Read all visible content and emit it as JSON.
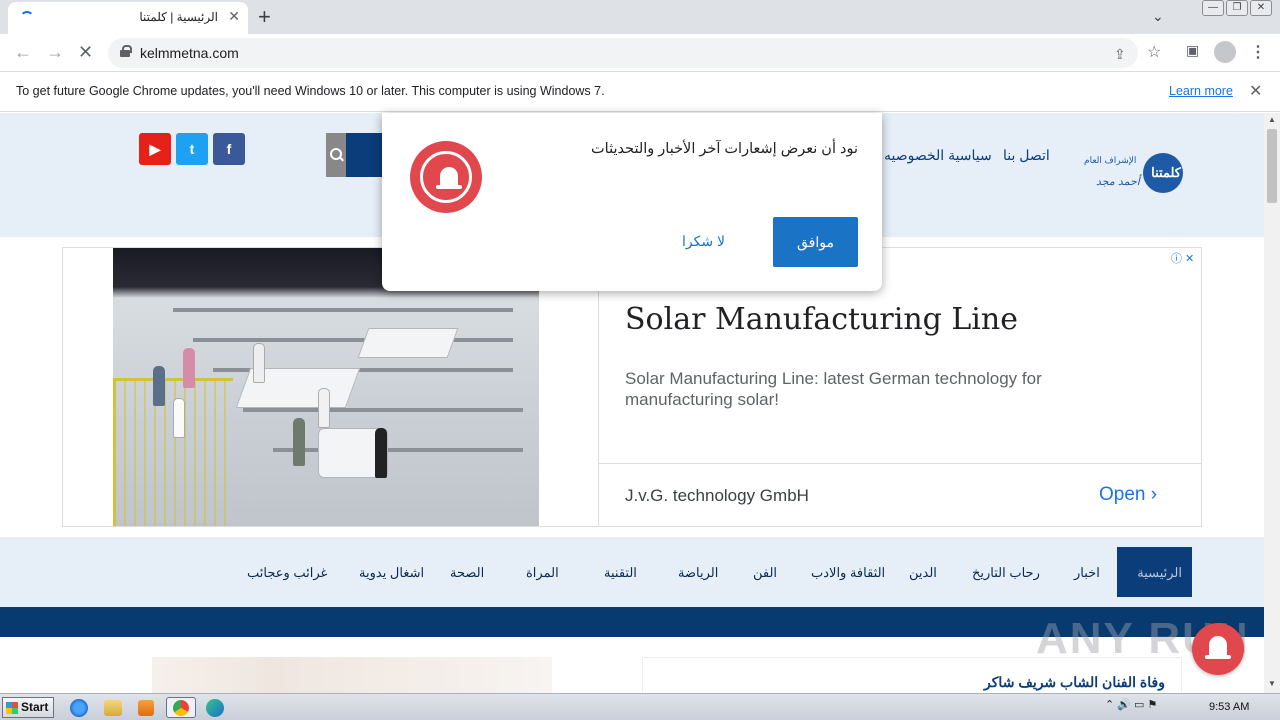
{
  "browser": {
    "tab_title": "الرئيسية | كلمتنا",
    "tab_close": "✕",
    "new_tab": "+",
    "tab_search": "⌄",
    "url": "kelmmetna.com",
    "nav_back": "←",
    "nav_forward": "→",
    "nav_stop": "✕",
    "share_icon": "⇪",
    "star_icon": "☆",
    "sidepanel_icon": "▣",
    "kebab": "⋮",
    "window_minimize": "—",
    "window_restore": "❐",
    "window_close": "✕"
  },
  "infobar": {
    "message": "To get future Google Chrome updates, you'll need Windows 10 or later. This computer is using Windows 7.",
    "learn_more": "Learn more",
    "close": "✕"
  },
  "site": {
    "logo_text": "كلمتنا",
    "logo_sub": "الإشراف العام",
    "logo_sign": "أحمد مجد",
    "topnav": [
      "اتصل بنا",
      "سياسية الخصوصيه"
    ],
    "social": [
      {
        "name": "youtube",
        "glyph": "▶",
        "color": "#e62117"
      },
      {
        "name": "twitter",
        "glyph": "t",
        "color": "#1da1f2"
      },
      {
        "name": "facebook",
        "glyph": "f",
        "color": "#3b5998"
      }
    ]
  },
  "prompt": {
    "text": "نود أن نعرض إشعارات آخر الأخبار والتحديثات",
    "allow": "موافق",
    "deny": "لا شكرا"
  },
  "ad": {
    "headline": "Solar Manufacturing Line",
    "description": "Solar Manufacturing Line: latest German technology for manufacturing solar!",
    "advertiser": "J.v.G. technology GmbH",
    "open": "Open",
    "open_chevron": "›",
    "adchoices": "ⓘ ✕"
  },
  "mainnav": {
    "active": "الرئيسية",
    "items": [
      "اخبار",
      "رحاب التاريخ",
      "الدين",
      "الثقافة والادب",
      "الفن",
      "الرياضة",
      "التقنية",
      "المراة",
      "الصحة",
      "اشغال يدوية",
      "غرائب وعجائب"
    ]
  },
  "article": {
    "title": "وفاة الفنان الشاب شريف شاكر"
  },
  "watermark": "ANY RUN",
  "taskbar": {
    "start": "Start",
    "clock": "9:53 AM",
    "tray": "⌃  🔊  ▭  ⚑"
  }
}
